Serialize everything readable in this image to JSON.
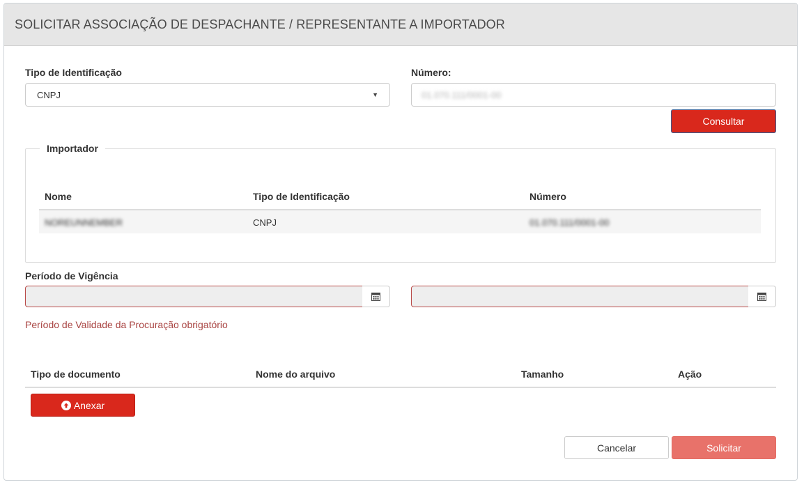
{
  "header": {
    "title": "SOLICITAR ASSOCIAÇÃO DE DESPACHANTE / REPRESENTANTE A IMPORTADOR"
  },
  "form": {
    "tipo_label": "Tipo de Identificação",
    "tipo_value": "CNPJ",
    "numero_label": "Número:",
    "numero_value": "01.070.111/0001-00",
    "consultar_label": "Consultar"
  },
  "importador": {
    "legend": "Importador",
    "columns": [
      "Nome",
      "Tipo de Identificação",
      "Número"
    ],
    "rows": [
      {
        "nome": "NOREUNNEMBER",
        "tipo": "CNPJ",
        "numero": "01.070.111/0001-00"
      }
    ]
  },
  "vigencia": {
    "label": "Período de Vigência",
    "start_value": "",
    "end_value": "",
    "error": "Período de Validade da Procuração obrigatório"
  },
  "documents": {
    "columns": [
      "Tipo de documento",
      "Nome do arquivo",
      "Tamanho",
      "Ação"
    ],
    "anexar_label": "Anexar"
  },
  "actions": {
    "cancel_label": "Cancelar",
    "submit_label": "Solicitar"
  },
  "colors": {
    "primary": "#d9281c",
    "primary_disabled": "#e8726a",
    "error": "#a94442",
    "header_bg": "#e6e6e6"
  },
  "icons": {
    "dropdown": "caret-down-icon",
    "calendar": "calendar-icon",
    "upload": "upload-circle-icon"
  }
}
